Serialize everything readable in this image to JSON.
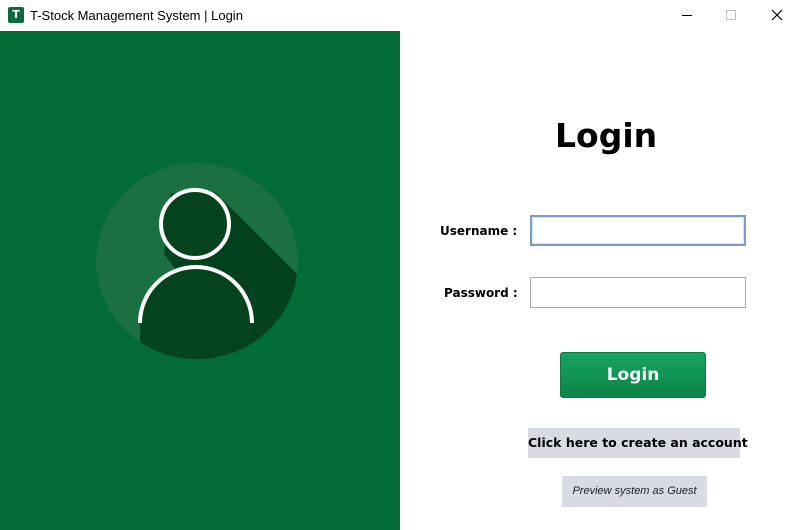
{
  "window": {
    "app_icon_letter": "T",
    "title": "T-Stock Management System | Login",
    "controls": {
      "minimize": "minimize",
      "maximize": "maximize",
      "close": "close"
    }
  },
  "left_panel": {
    "background": "#036b35",
    "avatar_icon": "user-icon"
  },
  "login_form": {
    "heading": "Login",
    "username_label": "Username :",
    "username_value": "",
    "password_label": "Password :",
    "password_value": "",
    "login_button": "Login",
    "create_account_button": "Click here to create an account",
    "guest_button": "Preview system as Guest"
  },
  "colors": {
    "primary_green": "#036b35",
    "button_green": "#0f8f4f",
    "secondary_button": "#d8dbe2"
  }
}
